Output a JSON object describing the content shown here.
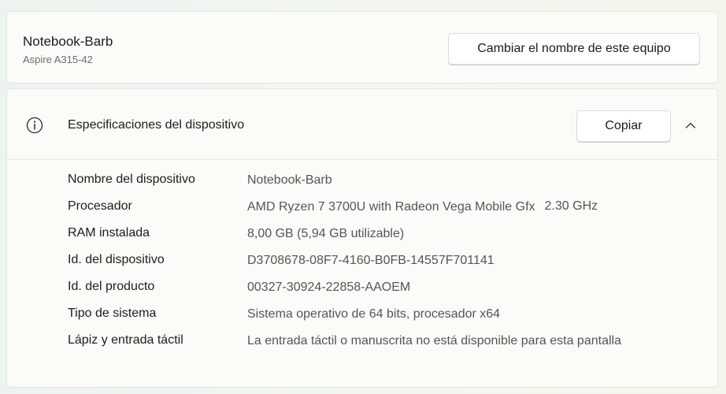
{
  "pc": {
    "name": "Notebook-Barb",
    "model": "Aspire A315-42",
    "rename_label": "Cambiar el nombre de este equipo"
  },
  "specs": {
    "title": "Especificaciones del dispositivo",
    "copy_label": "Copiar",
    "rows": [
      {
        "label": "Nombre del dispositivo",
        "value": "Notebook-Barb",
        "extra": ""
      },
      {
        "label": "Procesador",
        "value": "AMD Ryzen 7 3700U with Radeon Vega Mobile Gfx",
        "extra": "2.30 GHz"
      },
      {
        "label": "RAM instalada",
        "value": "8,00 GB (5,94 GB utilizable)",
        "extra": ""
      },
      {
        "label": "Id. del dispositivo",
        "value": "D3708678-08F7-4160-B0FB-14557F701141",
        "extra": ""
      },
      {
        "label": "Id. del producto",
        "value": "00327-30924-22858-AAOEM",
        "extra": ""
      },
      {
        "label": "Tipo de sistema",
        "value": "Sistema operativo de 64 bits, procesador x64",
        "extra": ""
      },
      {
        "label": "Lápiz y entrada táctil",
        "value": "La entrada táctil o manuscrita no está disponible para esta pantalla",
        "extra": ""
      }
    ]
  },
  "icons": {
    "info": "info-icon",
    "chevron": "chevron-up-icon"
  }
}
